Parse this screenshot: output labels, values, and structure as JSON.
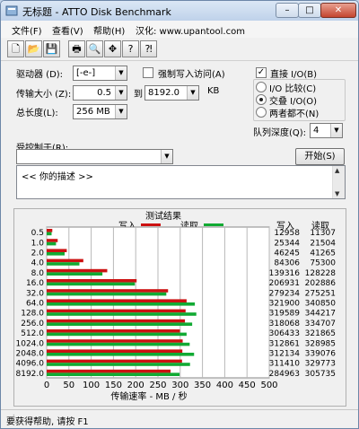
{
  "window": {
    "app_title": "无标题 - ATTO Disk Benchmark"
  },
  "menu": {
    "items": [
      "文件(F)",
      "查看(V)",
      "帮助(H)",
      "汉化: www.upantool.com"
    ]
  },
  "toolbar": {
    "icons": [
      "new-file-icon",
      "open-folder-icon",
      "save-icon",
      "print-icon",
      "print-preview-icon",
      "move-icon",
      "help-icon",
      "context-help-icon"
    ]
  },
  "form": {
    "drive_label": "驱动器 (D):",
    "drive_value": "[-e-]",
    "force_write_label": "强制写入访问(A)",
    "direct_io_label": "直接 I/O(B)",
    "transfer_label": "传输大小 (Z):",
    "transfer_from": "0.5",
    "transfer_to_label": "到",
    "transfer_to": "8192.0",
    "transfer_unit": "KB",
    "radio_io_compare": "I/O 比较(C)",
    "radio_overlap_io": "交叠 I/O(O)",
    "radio_neither": "两者都不(N)",
    "total_length_label": "总长度(L):",
    "total_length_value": "256 MB",
    "queue_depth_label": "队列深度(Q):",
    "queue_depth_value": "4",
    "controlled_by_label": "受控制于(R):",
    "controlled_by_value": "",
    "start_button": "开始(S)",
    "description": "<<  你的描述  >>"
  },
  "results": {
    "title": "测试结果",
    "write_legend": "写入",
    "read_legend": "读取",
    "write_header": "写入",
    "read_header": "读取",
    "xlabel": "传输速率 - MB / 秒",
    "write_color": "#cc1111",
    "read_color": "#11aa33"
  },
  "chart_data": {
    "type": "bar",
    "orientation": "horizontal",
    "title": "测试结果",
    "xlabel": "传输速率 - MB / 秒",
    "xlim": [
      0,
      500
    ],
    "xticks": [
      0,
      50,
      100,
      150,
      200,
      250,
      300,
      350,
      400,
      450,
      500
    ],
    "categories": [
      "0.5",
      "1.0",
      "2.0",
      "4.0",
      "8.0",
      "16.0",
      "32.0",
      "64.0",
      "128.0",
      "256.0",
      "512.0",
      "1024.0",
      "2048.0",
      "4096.0",
      "8192.0"
    ],
    "series": [
      {
        "name": "写入",
        "values": [
          12958,
          25344,
          46245,
          84306,
          139316,
          206931,
          279234,
          321900,
          319589,
          318068,
          306433,
          312861,
          312134,
          311410,
          284963
        ]
      },
      {
        "name": "读取",
        "values": [
          11307,
          21504,
          41265,
          75300,
          128228,
          202886,
          275251,
          340850,
          344217,
          334707,
          321865,
          328985,
          339076,
          329773,
          305735
        ]
      }
    ],
    "value_unit_note": "table values in KB/s; bar length plotted in MB/s"
  },
  "status": {
    "text": "要获得帮助, 请按 F1"
  }
}
